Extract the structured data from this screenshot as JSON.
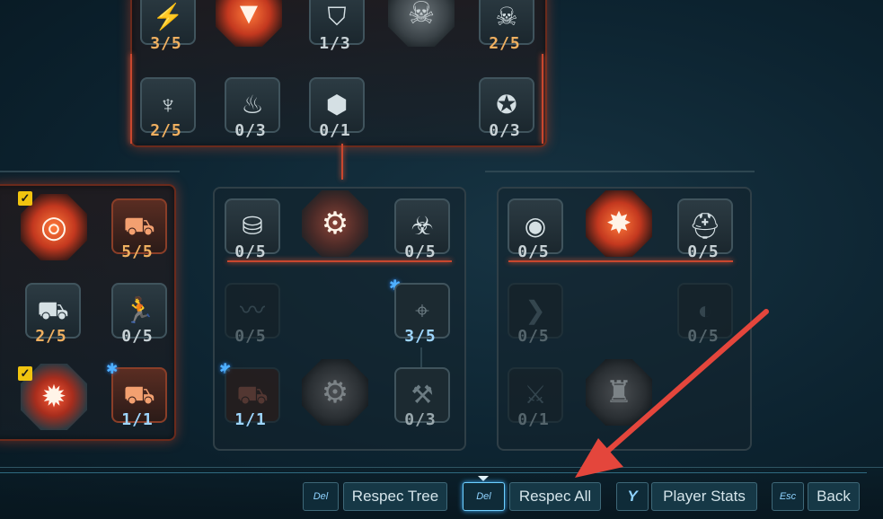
{
  "top_panel": {
    "row1": [
      {
        "icon": "brain-spark-icon",
        "count": "3/5",
        "variant": "normal"
      },
      {
        "icon": "chevron-badge-icon",
        "count": "",
        "variant": "orange-hex"
      },
      {
        "icon": "shield-icon",
        "count": "1/3",
        "variant": "normal"
      },
      {
        "icon": "jaw-icon",
        "count": "",
        "variant": "gray-hex"
      },
      {
        "icon": "skull-icon",
        "count": "2/5",
        "variant": "normal"
      }
    ],
    "row2": [
      {
        "icon": "wing-badge-icon",
        "count": "2/5"
      },
      {
        "icon": "flame-icon",
        "count": "0/3"
      },
      {
        "icon": "turtle-shell-icon",
        "count": "0/1"
      },
      {
        "icon": "star-shield-icon",
        "count": "0/3"
      }
    ]
  },
  "left_panel": {
    "nodes": [
      {
        "icon": "vortex-icon",
        "count": "",
        "checked": true
      },
      {
        "icon": "turret-icon",
        "count": "5/5"
      },
      {
        "icon": "drone-icon",
        "count": "2/5"
      },
      {
        "icon": "running-man-icon",
        "count": "0/5"
      },
      {
        "icon": "explosion-icon",
        "count": "",
        "checked": true
      },
      {
        "icon": "cannon-icon",
        "count": "1/1",
        "bug": true
      }
    ]
  },
  "middle_panel": {
    "nodes": [
      {
        "icon": "ammo-icon",
        "count": "0/5"
      },
      {
        "icon": "gun-turret-icon",
        "count": ""
      },
      {
        "icon": "biohazard-icon",
        "count": "0/5"
      },
      {
        "icon": "trail-icon",
        "count": "0/5"
      },
      {
        "icon": "crosshair-icon",
        "count": "3/5",
        "bug": true
      },
      {
        "icon": "cannon-icon",
        "count": "1/1",
        "bug": true
      },
      {
        "icon": "mech-icon",
        "count": ""
      },
      {
        "icon": "wrench-icon",
        "count": "0/3"
      }
    ]
  },
  "right_panel": {
    "nodes": [
      {
        "icon": "eye-visor-icon",
        "count": "0/5"
      },
      {
        "icon": "blast-icon",
        "count": ""
      },
      {
        "icon": "helmet-icon",
        "count": "0/5"
      },
      {
        "icon": "wing-icon",
        "count": "0/5"
      },
      {
        "icon": "mask-icon",
        "count": "0/5"
      },
      {
        "icon": "crossed-swords-icon",
        "count": "0/1"
      },
      {
        "icon": "claw-icon",
        "count": ""
      }
    ]
  },
  "bottom_bar": {
    "respec_tree": {
      "key": "Del",
      "label": "Respec Tree"
    },
    "respec_all": {
      "key": "Del",
      "label": "Respec All"
    },
    "player_stats": {
      "key": "Y",
      "label": "Player Stats"
    },
    "back": {
      "key": "Esc",
      "label": "Back"
    }
  },
  "annotation_arrow": {
    "color": "#e4463c"
  }
}
